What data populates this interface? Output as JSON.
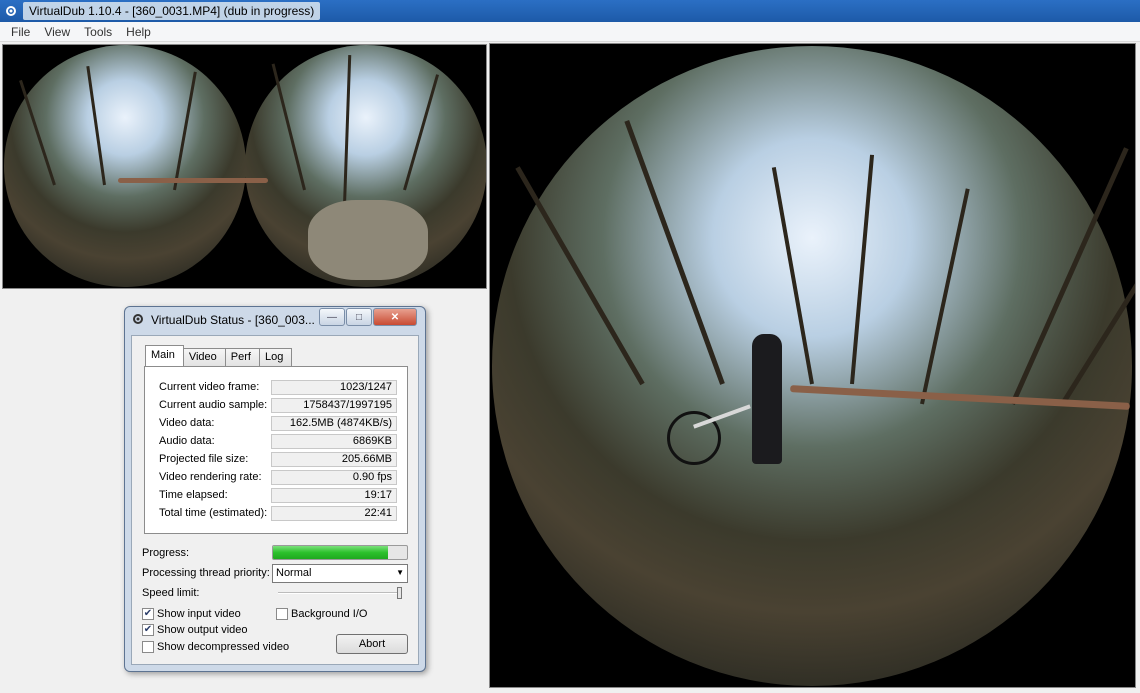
{
  "window": {
    "title": "VirtualDub 1.10.4 - [360_0031.MP4] (dub in progress)",
    "icon": "gear-icon"
  },
  "menu": [
    "File",
    "View",
    "Tools",
    "Help"
  ],
  "dialog": {
    "title": "VirtualDub Status - [360_003...",
    "tabs": [
      "Main",
      "Video",
      "Perf",
      "Log"
    ],
    "active_tab": "Main",
    "stats": [
      {
        "label": "Current video frame:",
        "value": "1023/1247"
      },
      {
        "label": "Current audio sample:",
        "value": "1758437/1997195"
      },
      {
        "label": "Video data:",
        "value": "162.5MB (4874KB/s)"
      },
      {
        "label": "Audio data:",
        "value": "6869KB"
      },
      {
        "label": "Projected file size:",
        "value": "205.66MB"
      },
      {
        "label": "Video rendering rate:",
        "value": "0.90 fps"
      },
      {
        "label": "Time elapsed:",
        "value": "19:17"
      },
      {
        "label": "Total time (estimated):",
        "value": "22:41"
      }
    ],
    "progress_label": "Progress:",
    "progress_fraction": 0.86,
    "priority_label": "Processing thread priority:",
    "priority_value": "Normal",
    "speed_label": "Speed limit:",
    "speed_fraction": 1.0,
    "checkboxes": {
      "show_input": {
        "label": "Show input video",
        "checked": true
      },
      "show_output": {
        "label": "Show output video",
        "checked": true
      },
      "show_decompressed": {
        "label": "Show decompressed video",
        "checked": false
      },
      "background_io": {
        "label": "Background I/O",
        "checked": false
      }
    },
    "abort_label": "Abort",
    "accent_color": "#2cc12c"
  }
}
